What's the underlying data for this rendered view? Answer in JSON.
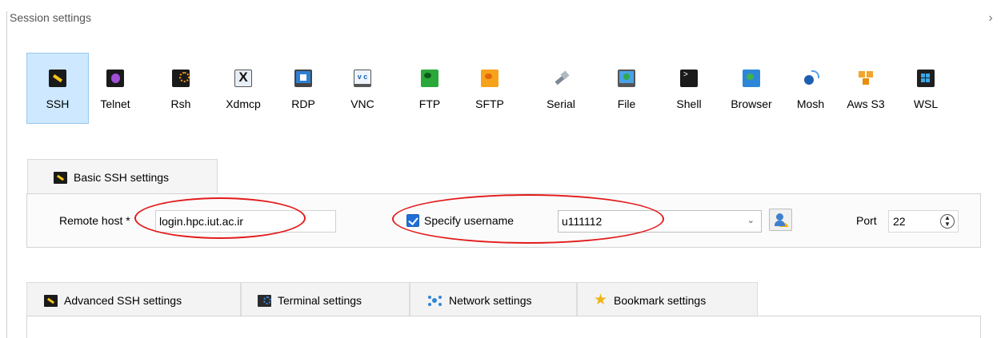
{
  "window": {
    "title": "Session settings",
    "close_glyph": "›"
  },
  "protocols": [
    {
      "label": "SSH",
      "icon": "ssh-key-icon",
      "selected": true
    },
    {
      "label": "Telnet",
      "icon": "telnet-icon"
    },
    {
      "label": "Rsh",
      "icon": "rsh-icon"
    },
    {
      "label": "Xdmcp",
      "icon": "xdmcp-icon"
    },
    {
      "label": "RDP",
      "icon": "rdp-icon"
    },
    {
      "label": "VNC",
      "icon": "vnc-icon"
    },
    {
      "label": "FTP",
      "icon": "ftp-globe-icon"
    },
    {
      "label": "SFTP",
      "icon": "sftp-globe-icon"
    },
    {
      "label": "Serial",
      "icon": "serial-plug-icon"
    },
    {
      "label": "File",
      "icon": "file-monitor-icon"
    },
    {
      "label": "Shell",
      "icon": "shell-terminal-icon"
    },
    {
      "label": "Browser",
      "icon": "browser-globe-icon"
    },
    {
      "label": "Mosh",
      "icon": "mosh-satellite-icon"
    },
    {
      "label": "Aws S3",
      "icon": "aws-s3-icon"
    },
    {
      "label": "WSL",
      "icon": "wsl-windows-icon"
    }
  ],
  "basic_ssh": {
    "tab_label": "Basic SSH settings",
    "remote_host_label": "Remote host *",
    "remote_host_value": "login.hpc.iut.ac.ir",
    "specify_username_label": "Specify username",
    "specify_username_checked": true,
    "username_value": "u111112",
    "port_label": "Port",
    "port_value": "22"
  },
  "bottom_tabs": [
    {
      "label": "Advanced SSH settings",
      "icon": "key-icon"
    },
    {
      "label": "Terminal settings",
      "icon": "terminal-icon"
    },
    {
      "label": "Network settings",
      "icon": "network-icon"
    },
    {
      "label": "Bookmark settings",
      "icon": "star-icon"
    }
  ],
  "annotation_color": "#e31b1b",
  "accent_color": "#cde8ff"
}
